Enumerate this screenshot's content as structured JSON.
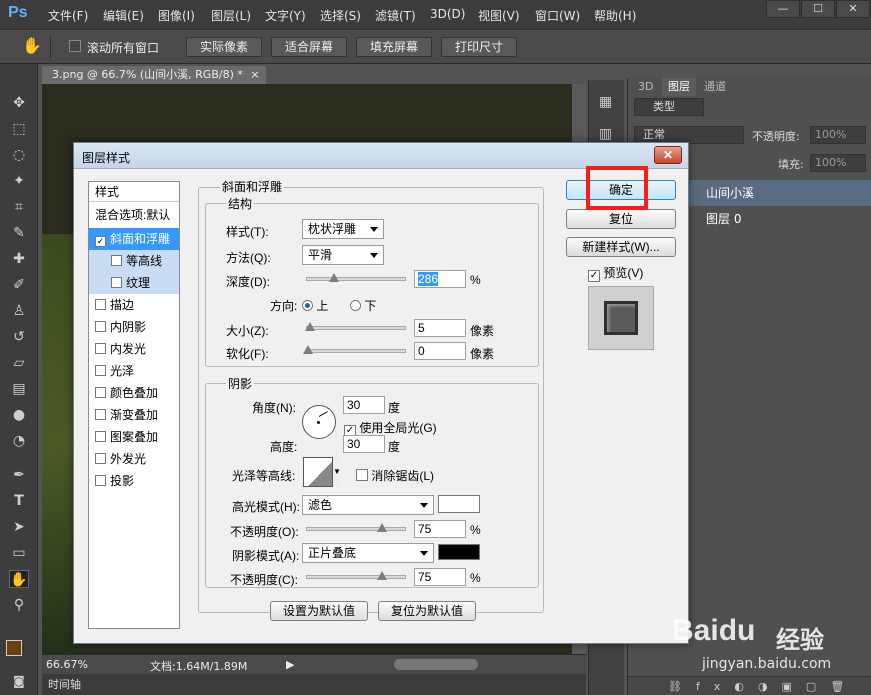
{
  "menubar": {
    "logo": "Ps",
    "items": [
      "文件(F)",
      "编辑(E)",
      "图像(I)",
      "图层(L)",
      "文字(Y)",
      "选择(S)",
      "滤镜(T)",
      "3D(D)",
      "视图(V)",
      "窗口(W)",
      "帮助(H)"
    ],
    "window_buttons": [
      "—",
      "☐",
      "✕"
    ]
  },
  "options": {
    "scroll_all": "滚动所有窗口",
    "buttons": [
      "实际像素",
      "适合屏幕",
      "填充屏幕",
      "打印尺寸"
    ]
  },
  "document": {
    "tab_title": "3.png @ 66.7% (山间小溪, RGB/8) *",
    "zoom": "66.67%",
    "doc_info": "文档:1.64M/1.89M",
    "timeline": "时间轴"
  },
  "panels": {
    "tabs": [
      "3D",
      "图层",
      "通道"
    ],
    "filter_type": "类型",
    "blend_mode": "正常",
    "opacity_label": "不透明度:",
    "opacity_value": "100%",
    "fill_label": "填充:",
    "fill_value": "100%",
    "lock_label": "锁定:",
    "layers": [
      "山间小溪",
      "图层 0"
    ]
  },
  "dialog": {
    "title": "图层样式",
    "style_list": {
      "header": "样式",
      "items": [
        "混合选项:默认",
        "斜面和浮雕",
        "等高线",
        "纹理",
        "描边",
        "内阴影",
        "内发光",
        "光泽",
        "颜色叠加",
        "渐变叠加",
        "图案叠加",
        "外发光",
        "投影"
      ]
    },
    "bevel": {
      "section_title": "斜面和浮雕",
      "structure_title": "结构",
      "style_label": "样式(T):",
      "style_value": "枕状浮雕",
      "technique_label": "方法(Q):",
      "technique_value": "平滑",
      "depth_label": "深度(D):",
      "depth_value": "286",
      "depth_unit": "%",
      "direction_label": "方向:",
      "direction_up": "上",
      "direction_down": "下",
      "size_label": "大小(Z):",
      "size_value": "5",
      "size_unit": "像素",
      "soften_label": "软化(F):",
      "soften_value": "0",
      "soften_unit": "像素"
    },
    "shading": {
      "title": "阴影",
      "angle_label": "角度(N):",
      "angle_value": "30",
      "angle_unit": "度",
      "global_light": "使用全局光(G)",
      "altitude_label": "高度:",
      "altitude_value": "30",
      "altitude_unit": "度",
      "gloss_label": "光泽等高线:",
      "anti_alias": "消除锯齿(L)",
      "highlight_label": "高光模式(H):",
      "highlight_value": "滤色",
      "highlight_color": "#ffffff",
      "hl_opacity_label": "不透明度(O):",
      "hl_opacity_value": "75",
      "hl_opacity_unit": "%",
      "shadow_label": "阴影模式(A):",
      "shadow_value": "正片叠底",
      "shadow_color": "#000000",
      "sh_opacity_label": "不透明度(C):",
      "sh_opacity_value": "75",
      "sh_opacity_unit": "%"
    },
    "buttons": {
      "ok": "确定",
      "reset": "复位",
      "new_style": "新建样式(W)...",
      "preview": "预览(V)",
      "make_default": "设置为默认值",
      "reset_default": "复位为默认值"
    }
  },
  "watermark": {
    "brand_cn": "经验",
    "url": "jingyan.baidu.com"
  }
}
